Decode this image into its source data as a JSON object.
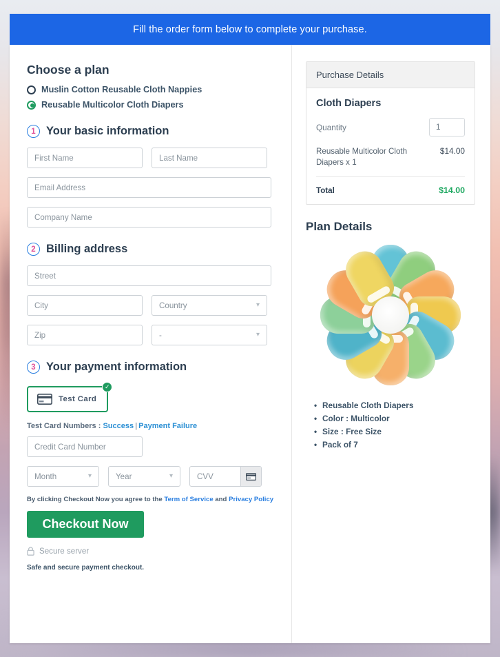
{
  "header": {
    "banner_text": "Fill the order form below to complete your purchase."
  },
  "plans": {
    "title": "Choose a plan",
    "options": [
      {
        "label": "Muslin Cotton Reusable Cloth Nappies",
        "selected": false
      },
      {
        "label": "Reusable Multicolor Cloth Diapers",
        "selected": true
      }
    ]
  },
  "steps": {
    "basic": {
      "number": "1",
      "title": "Your basic information"
    },
    "billing": {
      "number": "2",
      "title": "Billing address"
    },
    "payment": {
      "number": "3",
      "title": "Your payment information"
    }
  },
  "basic_fields": {
    "first_name": {
      "placeholder": "First Name",
      "value": ""
    },
    "last_name": {
      "placeholder": "Last Name",
      "value": ""
    },
    "email": {
      "placeholder": "Email Address",
      "value": ""
    },
    "company": {
      "placeholder": "Company Name",
      "value": ""
    }
  },
  "billing_fields": {
    "street": {
      "placeholder": "Street",
      "value": ""
    },
    "city": {
      "placeholder": "City",
      "value": ""
    },
    "country": {
      "placeholder": "Country",
      "value": ""
    },
    "zip": {
      "placeholder": "Zip",
      "value": ""
    },
    "state": {
      "placeholder": "-",
      "value": "-"
    }
  },
  "payment": {
    "test_card_label": "Test  Card",
    "test_numbers_prefix": "Test Card Numbers :",
    "success_link": "Success",
    "separator": "|",
    "failure_link": "Payment Failure",
    "card_number": {
      "placeholder": "Credit Card Number",
      "value": ""
    },
    "month": {
      "placeholder": "Month",
      "value": ""
    },
    "year": {
      "placeholder": "Year",
      "value": ""
    },
    "cvv": {
      "placeholder": "CVV",
      "value": ""
    }
  },
  "footer": {
    "terms_prefix": "By clicking Checkout Now you agree to the",
    "terms_link": "Term of Service",
    "terms_and": "and",
    "privacy_link": "Privacy Policy",
    "checkout_label": "Checkout Now",
    "secure_label": "Secure server",
    "safe_note": "Safe and secure payment checkout."
  },
  "purchase": {
    "panel_title": "Purchase Details",
    "product_name": "Cloth Diapers",
    "quantity_label": "Quantity",
    "quantity_value": "1",
    "line_item_desc": "Reusable Multicolor Cloth Diapers x 1",
    "line_item_amount": "$14.00",
    "total_label": "Total",
    "total_amount": "$14.00"
  },
  "plan_details": {
    "title": "Plan Details",
    "bullets": [
      "Reusable Cloth Diapers",
      "Color : Multicolor",
      "Size : Free Size",
      "Pack of 7"
    ]
  },
  "colors": {
    "banner_blue": "#1c66e5",
    "accent_green": "#1f9b5f",
    "total_green": "#1fa861",
    "link_blue": "#2b7fe0",
    "step_circle_blue": "#2b7fe0",
    "step_number_pink": "#e0559b"
  }
}
